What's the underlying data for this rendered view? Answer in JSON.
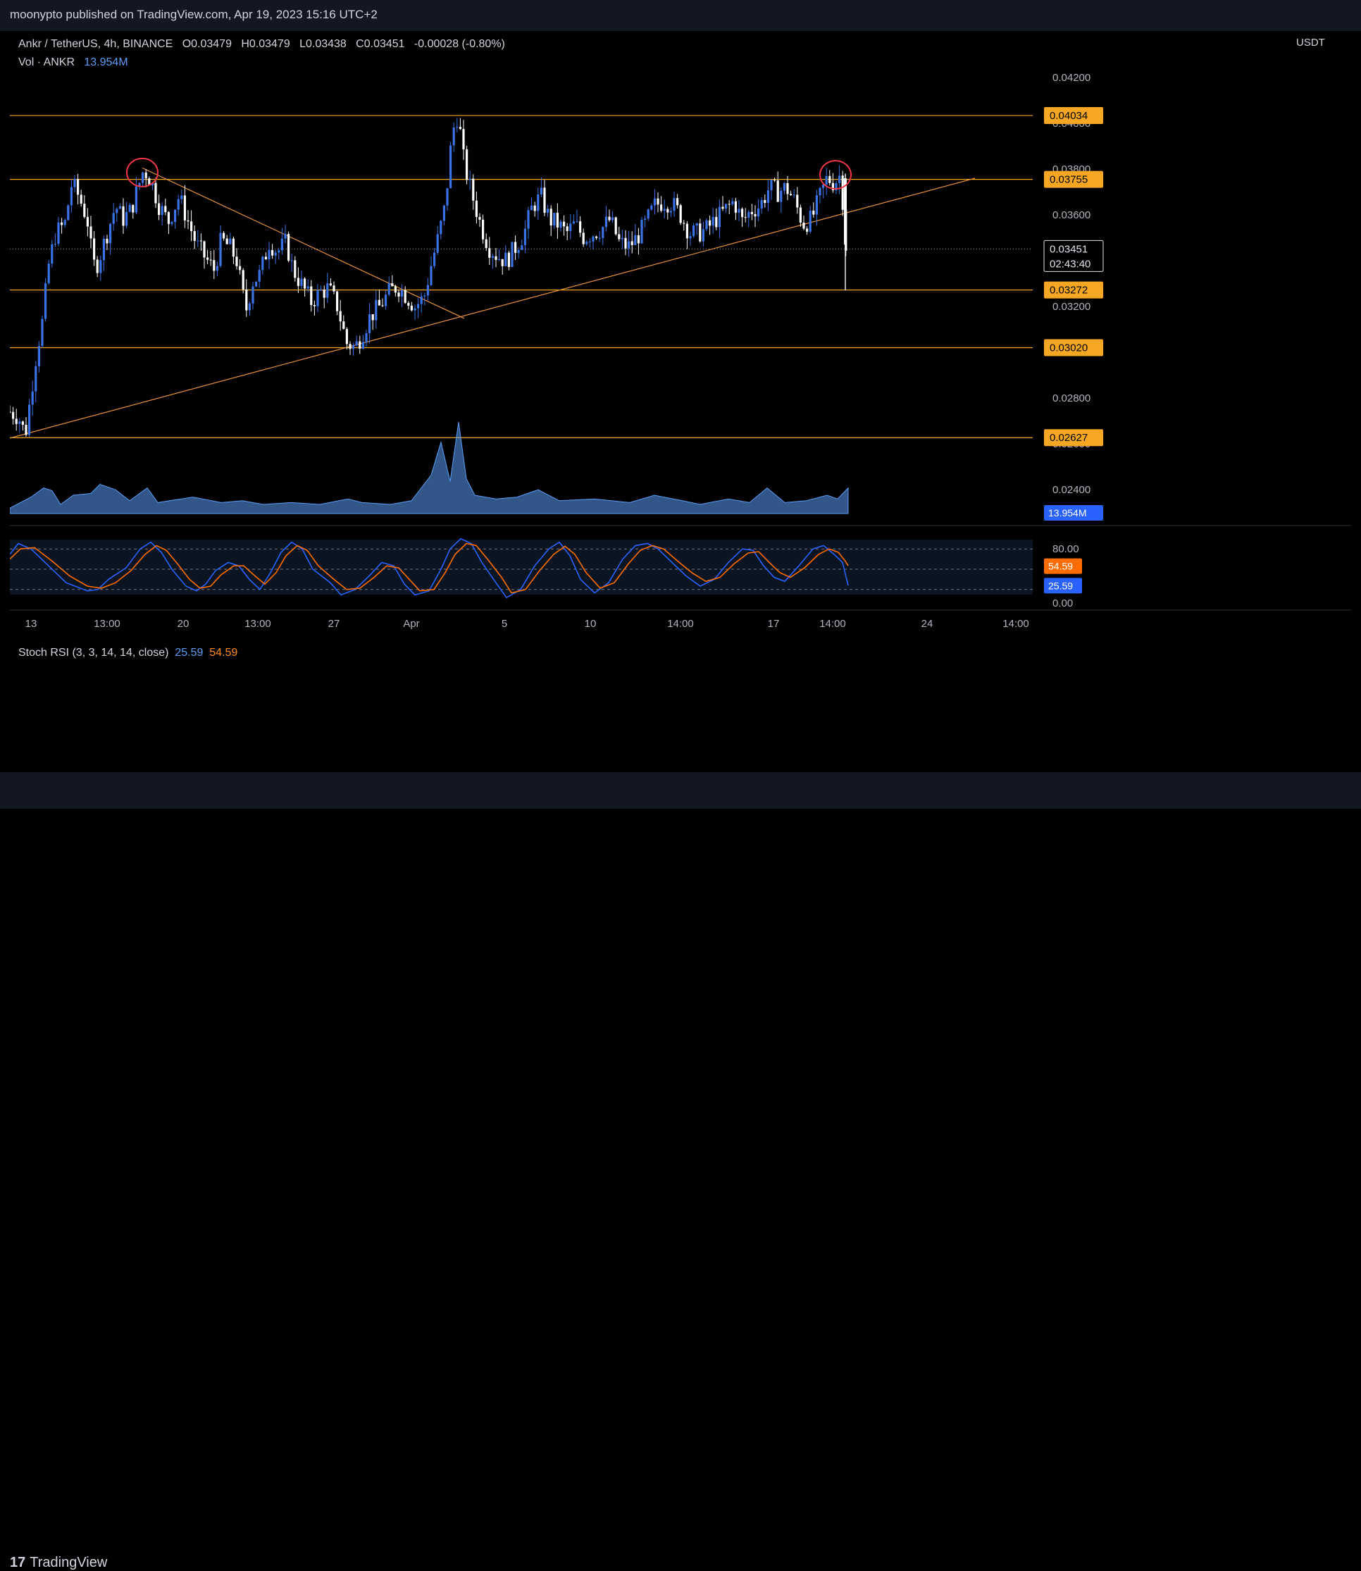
{
  "header": {
    "publish_line": "moonypto published on TradingView.com, Apr 19, 2023 15:16 UTC+2"
  },
  "footer": {
    "brand": "TradingView",
    "logo_mark": "17"
  },
  "legend": {
    "symbol": "Ankr / TetherUS, 4h, BINANCE",
    "o_label": "O",
    "o_value": "0.03479",
    "h_label": "H",
    "h_value": "0.03479",
    "l_label": "L",
    "l_value": "0.03438",
    "c_label": "C",
    "c_value": "0.03451",
    "change": "-0.00028 (-0.80%)",
    "vol_label": "Vol · ANKR",
    "vol_value": "13.954M",
    "stoch_label": "Stoch RSI (3, 3, 14, 14, close)",
    "stoch_k": "25.59",
    "stoch_d": "54.59"
  },
  "colors": {
    "bull": "#3a73e8",
    "bear": "#ffffff",
    "hline": "#f5a623",
    "trend": "#e8913a",
    "circle": "#f23645",
    "stoch_k": "#2962ff",
    "stoch_d": "#ff6d00",
    "volume": "#5b9cf6"
  },
  "chart_data": {
    "type": "candlestick",
    "symbol": "Ankr / TetherUS",
    "timeframe": "4h",
    "exchange": "BINANCE",
    "currency": "USDT",
    "y_ticks": [
      "0.04200",
      "0.04000",
      "0.03800",
      "0.03600",
      "0.03400",
      "0.03200",
      "0.03000",
      "0.02800",
      "0.02600",
      "0.02400"
    ],
    "ylim": [
      0.0228,
      0.0436
    ],
    "x_ticks": [
      "13",
      "13:00",
      "20",
      "13:00",
      "27",
      "Apr",
      "5",
      "10",
      "14:00",
      "17",
      "14:00",
      "24",
      "14:00"
    ],
    "last_price": "0.03451",
    "countdown": "02:43:40",
    "horizontal_levels": [
      "0.04034",
      "0.03755",
      "0.03272",
      "0.03020",
      "0.02627"
    ],
    "trendlines": [
      {
        "from": [
          0,
          0.02625
        ],
        "to": [
          1370,
          0.0376
        ]
      },
      {
        "from": [
          188,
          0.03805
        ],
        "to": [
          645,
          0.03148
        ]
      }
    ],
    "anomaly_circles": [
      {
        "x": 188,
        "y": 0.03785
      },
      {
        "x": 1172,
        "y": 0.03775
      }
    ],
    "price_path": [
      [
        0,
        0.0274
      ],
      [
        12,
        0.0272
      ],
      [
        22,
        0.0264
      ],
      [
        30,
        0.0282
      ],
      [
        38,
        0.03
      ],
      [
        46,
        0.0313
      ],
      [
        55,
        0.0338
      ],
      [
        65,
        0.0352
      ],
      [
        78,
        0.0356
      ],
      [
        88,
        0.0374
      ],
      [
        98,
        0.0368
      ],
      [
        110,
        0.0358
      ],
      [
        118,
        0.0338
      ],
      [
        125,
        0.0339
      ],
      [
        138,
        0.0352
      ],
      [
        150,
        0.0364
      ],
      [
        160,
        0.0358
      ],
      [
        172,
        0.0362
      ],
      [
        180,
        0.037
      ],
      [
        190,
        0.038
      ],
      [
        200,
        0.0375
      ],
      [
        212,
        0.0364
      ],
      [
        225,
        0.0357
      ],
      [
        240,
        0.0368
      ],
      [
        252,
        0.0358
      ],
      [
        265,
        0.0347
      ],
      [
        278,
        0.0341
      ],
      [
        290,
        0.0336
      ],
      [
        300,
        0.0349
      ],
      [
        312,
        0.0346
      ],
      [
        322,
        0.034
      ],
      [
        335,
        0.0318
      ],
      [
        345,
        0.0331
      ],
      [
        355,
        0.0334
      ],
      [
        368,
        0.0348
      ],
      [
        380,
        0.0344
      ],
      [
        392,
        0.0348
      ],
      [
        402,
        0.0336
      ],
      [
        415,
        0.0329
      ],
      [
        428,
        0.0322
      ],
      [
        440,
        0.0326
      ],
      [
        452,
        0.0328
      ],
      [
        465,
        0.032
      ],
      [
        478,
        0.0304
      ],
      [
        490,
        0.0302
      ],
      [
        500,
        0.0308
      ],
      [
        512,
        0.0316
      ],
      [
        525,
        0.032
      ],
      [
        538,
        0.0326
      ],
      [
        550,
        0.0329
      ],
      [
        562,
        0.0325
      ],
      [
        575,
        0.032
      ],
      [
        588,
        0.0324
      ],
      [
        598,
        0.0338
      ],
      [
        608,
        0.035
      ],
      [
        618,
        0.0364
      ],
      [
        628,
        0.0396
      ],
      [
        636,
        0.0404
      ],
      [
        645,
        0.0382
      ],
      [
        655,
        0.037
      ],
      [
        668,
        0.0356
      ],
      [
        680,
        0.0346
      ],
      [
        692,
        0.0342
      ],
      [
        705,
        0.034
      ],
      [
        718,
        0.0346
      ],
      [
        730,
        0.0352
      ],
      [
        742,
        0.0364
      ],
      [
        754,
        0.0368
      ],
      [
        766,
        0.0358
      ],
      [
        778,
        0.0356
      ],
      [
        790,
        0.0352
      ],
      [
        802,
        0.0356
      ],
      [
        815,
        0.035
      ],
      [
        828,
        0.0352
      ],
      [
        840,
        0.0354
      ],
      [
        852,
        0.0358
      ],
      [
        865,
        0.0348
      ],
      [
        878,
        0.0346
      ],
      [
        890,
        0.035
      ],
      [
        902,
        0.0356
      ],
      [
        915,
        0.0364
      ],
      [
        928,
        0.0366
      ],
      [
        940,
        0.0365
      ],
      [
        952,
        0.036
      ],
      [
        965,
        0.0352
      ],
      [
        978,
        0.0352
      ],
      [
        990,
        0.0354
      ],
      [
        1002,
        0.0358
      ],
      [
        1015,
        0.0362
      ],
      [
        1028,
        0.0366
      ],
      [
        1040,
        0.0357
      ],
      [
        1052,
        0.0362
      ],
      [
        1065,
        0.0364
      ],
      [
        1078,
        0.0372
      ],
      [
        1090,
        0.037
      ],
      [
        1102,
        0.0372
      ],
      [
        1114,
        0.0366
      ],
      [
        1126,
        0.0356
      ],
      [
        1138,
        0.0358
      ],
      [
        1150,
        0.0368
      ],
      [
        1160,
        0.0376
      ],
      [
        1170,
        0.0374
      ],
      [
        1180,
        0.0378
      ],
      [
        1186,
        0.0347
      ],
      [
        1190,
        0.0345
      ]
    ],
    "volume_peaks": [
      [
        0,
        6
      ],
      [
        30,
        18
      ],
      [
        48,
        28
      ],
      [
        60,
        25
      ],
      [
        72,
        10
      ],
      [
        90,
        20
      ],
      [
        115,
        22
      ],
      [
        128,
        32
      ],
      [
        150,
        26
      ],
      [
        170,
        14
      ],
      [
        195,
        28
      ],
      [
        210,
        12
      ],
      [
        260,
        18
      ],
      [
        300,
        12
      ],
      [
        330,
        14
      ],
      [
        360,
        10
      ],
      [
        400,
        12
      ],
      [
        440,
        10
      ],
      [
        480,
        16
      ],
      [
        500,
        12
      ],
      [
        540,
        10
      ],
      [
        570,
        14
      ],
      [
        598,
        42
      ],
      [
        612,
        78
      ],
      [
        625,
        35
      ],
      [
        637,
        100
      ],
      [
        648,
        38
      ],
      [
        660,
        20
      ],
      [
        690,
        16
      ],
      [
        720,
        18
      ],
      [
        750,
        26
      ],
      [
        780,
        14
      ],
      [
        830,
        16
      ],
      [
        880,
        12
      ],
      [
        915,
        20
      ],
      [
        955,
        14
      ],
      [
        980,
        10
      ],
      [
        1020,
        16
      ],
      [
        1050,
        12
      ],
      [
        1075,
        28
      ],
      [
        1100,
        12
      ],
      [
        1130,
        14
      ],
      [
        1160,
        20
      ],
      [
        1175,
        16
      ],
      [
        1190,
        28
      ]
    ],
    "stoch_ticks": [
      "80.00",
      "0.00"
    ],
    "stoch_k_path": [
      [
        0,
        72
      ],
      [
        12,
        88
      ],
      [
        30,
        80
      ],
      [
        55,
        55
      ],
      [
        80,
        30
      ],
      [
        110,
        18
      ],
      [
        125,
        20
      ],
      [
        140,
        35
      ],
      [
        165,
        52
      ],
      [
        185,
        80
      ],
      [
        200,
        90
      ],
      [
        215,
        75
      ],
      [
        230,
        50
      ],
      [
        250,
        25
      ],
      [
        265,
        18
      ],
      [
        278,
        28
      ],
      [
        292,
        48
      ],
      [
        310,
        60
      ],
      [
        325,
        55
      ],
      [
        340,
        35
      ],
      [
        355,
        20
      ],
      [
        370,
        45
      ],
      [
        385,
        75
      ],
      [
        400,
        90
      ],
      [
        415,
        80
      ],
      [
        430,
        50
      ],
      [
        455,
        30
      ],
      [
        470,
        12
      ],
      [
        490,
        20
      ],
      [
        510,
        40
      ],
      [
        528,
        60
      ],
      [
        545,
        55
      ],
      [
        560,
        28
      ],
      [
        575,
        12
      ],
      [
        595,
        18
      ],
      [
        612,
        50
      ],
      [
        625,
        80
      ],
      [
        640,
        95
      ],
      [
        655,
        88
      ],
      [
        670,
        60
      ],
      [
        690,
        30
      ],
      [
        705,
        8
      ],
      [
        725,
        20
      ],
      [
        745,
        55
      ],
      [
        765,
        80
      ],
      [
        780,
        90
      ],
      [
        795,
        70
      ],
      [
        810,
        35
      ],
      [
        830,
        15
      ],
      [
        850,
        30
      ],
      [
        870,
        65
      ],
      [
        888,
        85
      ],
      [
        905,
        88
      ],
      [
        920,
        80
      ],
      [
        940,
        60
      ],
      [
        960,
        40
      ],
      [
        980,
        25
      ],
      [
        1000,
        35
      ],
      [
        1020,
        60
      ],
      [
        1040,
        80
      ],
      [
        1055,
        78
      ],
      [
        1070,
        55
      ],
      [
        1085,
        38
      ],
      [
        1100,
        32
      ],
      [
        1120,
        55
      ],
      [
        1140,
        80
      ],
      [
        1155,
        85
      ],
      [
        1170,
        72
      ],
      [
        1182,
        60
      ],
      [
        1190,
        26
      ]
    ],
    "stoch_d_path": [
      [
        0,
        65
      ],
      [
        15,
        80
      ],
      [
        35,
        82
      ],
      [
        60,
        62
      ],
      [
        85,
        40
      ],
      [
        110,
        25
      ],
      [
        130,
        22
      ],
      [
        150,
        30
      ],
      [
        172,
        48
      ],
      [
        192,
        72
      ],
      [
        208,
        85
      ],
      [
        222,
        78
      ],
      [
        238,
        58
      ],
      [
        255,
        35
      ],
      [
        270,
        22
      ],
      [
        285,
        25
      ],
      [
        300,
        42
      ],
      [
        318,
        55
      ],
      [
        332,
        55
      ],
      [
        348,
        40
      ],
      [
        362,
        28
      ],
      [
        378,
        45
      ],
      [
        392,
        70
      ],
      [
        408,
        85
      ],
      [
        422,
        78
      ],
      [
        438,
        55
      ],
      [
        460,
        35
      ],
      [
        478,
        20
      ],
      [
        497,
        22
      ],
      [
        517,
        38
      ],
      [
        535,
        55
      ],
      [
        552,
        52
      ],
      [
        567,
        35
      ],
      [
        582,
        18
      ],
      [
        602,
        20
      ],
      [
        618,
        45
      ],
      [
        632,
        72
      ],
      [
        648,
        88
      ],
      [
        662,
        85
      ],
      [
        678,
        65
      ],
      [
        698,
        38
      ],
      [
        712,
        15
      ],
      [
        732,
        20
      ],
      [
        752,
        48
      ],
      [
        772,
        72
      ],
      [
        788,
        84
      ],
      [
        802,
        72
      ],
      [
        818,
        45
      ],
      [
        838,
        22
      ],
      [
        858,
        30
      ],
      [
        878,
        58
      ],
      [
        895,
        78
      ],
      [
        912,
        85
      ],
      [
        928,
        80
      ],
      [
        948,
        62
      ],
      [
        968,
        45
      ],
      [
        988,
        32
      ],
      [
        1008,
        38
      ],
      [
        1028,
        58
      ],
      [
        1048,
        74
      ],
      [
        1063,
        76
      ],
      [
        1078,
        60
      ],
      [
        1093,
        45
      ],
      [
        1108,
        38
      ],
      [
        1128,
        52
      ],
      [
        1148,
        72
      ],
      [
        1163,
        80
      ],
      [
        1176,
        75
      ],
      [
        1186,
        62
      ],
      [
        1190,
        55
      ]
    ]
  }
}
